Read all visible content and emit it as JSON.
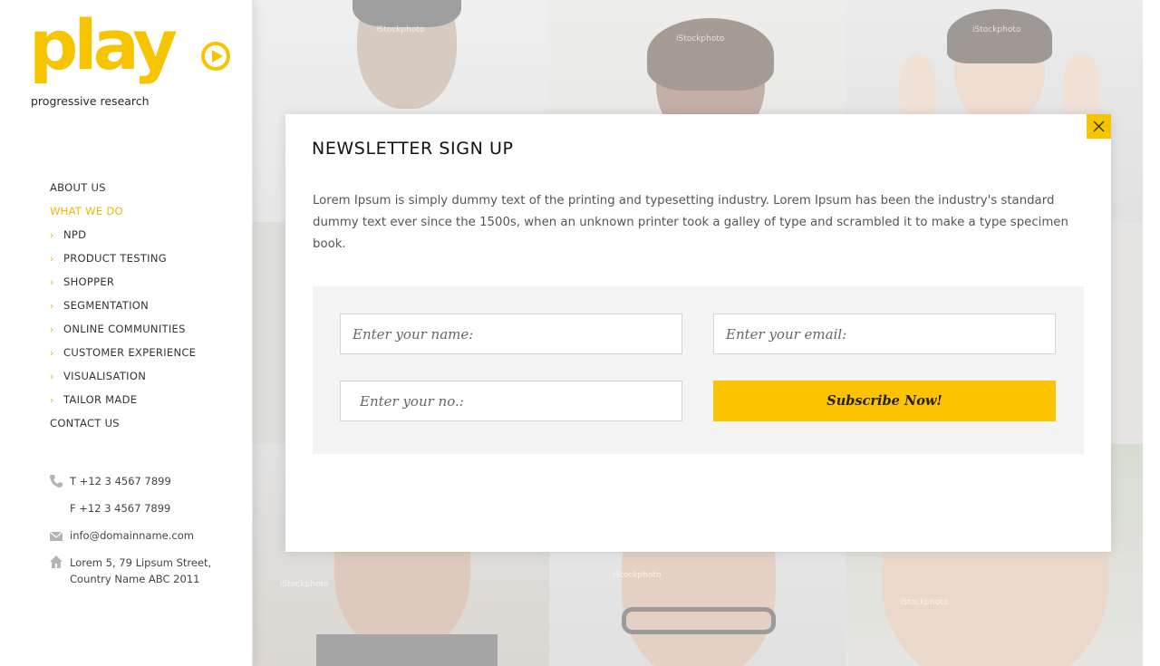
{
  "brand": {
    "logo_word": "play",
    "tagline": "progressive research",
    "accent": "#f7c500"
  },
  "nav": {
    "items": [
      {
        "label": "ABOUT US",
        "level": "top",
        "active": false
      },
      {
        "label": "WHAT WE DO",
        "level": "top",
        "active": true
      },
      {
        "label": "NPD",
        "level": "sub"
      },
      {
        "label": "PRODUCT TESTING",
        "level": "sub"
      },
      {
        "label": "SHOPPER",
        "level": "sub"
      },
      {
        "label": "SEGMENTATION",
        "level": "sub"
      },
      {
        "label": "ONLINE COMMUNITIES",
        "level": "sub"
      },
      {
        "label": "CUSTOMER EXPERIENCE",
        "level": "sub"
      },
      {
        "label": "VISUALISATION",
        "level": "sub"
      },
      {
        "label": "TAILOR MADE",
        "level": "sub"
      },
      {
        "label": "CONTACT US",
        "level": "top",
        "active": false
      }
    ],
    "sub_marker": "›"
  },
  "contact": {
    "phone": "T +12 3 4567 7899",
    "fax": "F +12 3 4567 7899",
    "email": "info@domainname.com",
    "address_line1": "Lorem 5, 79 Lipsum Street,",
    "address_line2": "Country Name ABC 2011",
    "icons": [
      "phone-icon",
      "mail-icon",
      "home-icon"
    ]
  },
  "background": {
    "watermark": "iStockphoto"
  },
  "modal": {
    "title": "NEWSLETTER SIGN UP",
    "body": "Lorem Ipsum is simply dummy text of the printing and typesetting industry. Lorem Ipsum has been the industry's standard dummy text ever since the 1500s, when an unknown printer took a galley of type and scrambled it to make a type specimen book.",
    "name_placeholder": "Enter your name:",
    "email_placeholder": "Enter your email:",
    "number_placeholder": "Enter your no.:",
    "submit_label": "Subscribe Now!",
    "close_icon": "close-icon"
  }
}
